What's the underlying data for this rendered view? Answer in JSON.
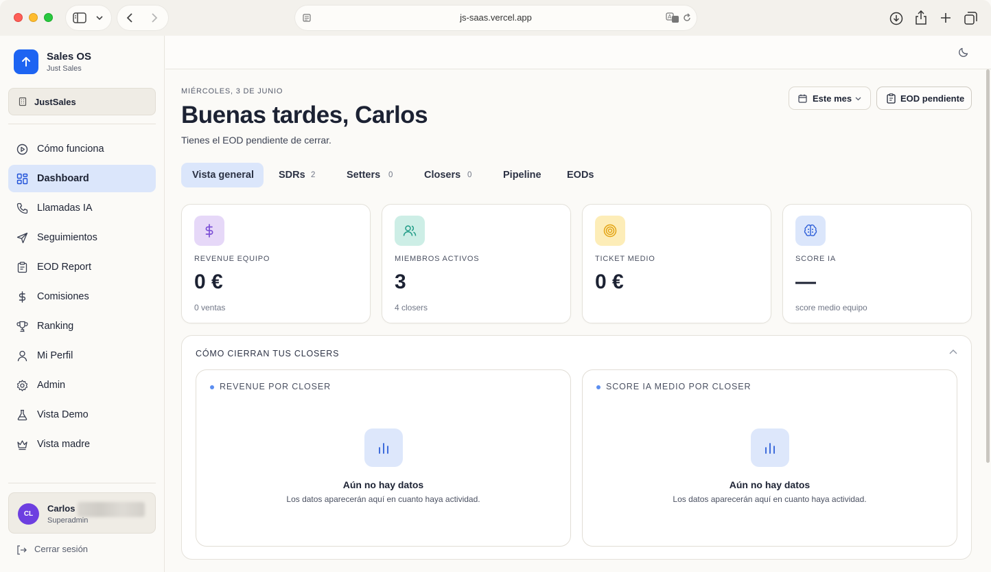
{
  "browser": {
    "url": "js-saas.vercel.app"
  },
  "sidebar": {
    "brand_name": "Sales OS",
    "brand_sub": "Just Sales",
    "workspace": "JustSales",
    "items": [
      {
        "label": "Cómo funciona",
        "icon": "play-circle-icon"
      },
      {
        "label": "Dashboard",
        "icon": "layout-grid-icon",
        "active": true
      },
      {
        "label": "Llamadas IA",
        "icon": "phone-icon"
      },
      {
        "label": "Seguimientos",
        "icon": "send-icon"
      },
      {
        "label": "EOD Report",
        "icon": "clipboard-icon"
      },
      {
        "label": "Comisiones",
        "icon": "dollar-icon"
      },
      {
        "label": "Ranking",
        "icon": "trophy-icon"
      },
      {
        "label": "Mi Perfil",
        "icon": "user-icon"
      },
      {
        "label": "Admin",
        "icon": "gear-icon"
      },
      {
        "label": "Vista Demo",
        "icon": "flask-icon"
      },
      {
        "label": "Vista madre",
        "icon": "crown-icon"
      }
    ],
    "user": {
      "initials": "CL",
      "name": "Carlos",
      "role": "Superadmin"
    },
    "logout": "Cerrar sesión"
  },
  "header": {
    "date": "MIÉRCOLES, 3 DE JUNIO",
    "greeting": "Buenas tardes, Carlos",
    "subtitle": "Tienes el EOD pendiente de cerrar.",
    "period_button": "Este mes",
    "eod_button": "EOD pendiente"
  },
  "tabs": [
    {
      "label": "Vista general",
      "count": ""
    },
    {
      "label": "SDRs",
      "count": "2"
    },
    {
      "label": "Setters",
      "count": "0"
    },
    {
      "label": "Closers",
      "count": "0"
    },
    {
      "label": "Pipeline",
      "count": ""
    },
    {
      "label": "EODs",
      "count": ""
    }
  ],
  "stats": [
    {
      "label": "REVENUE EQUIPO",
      "value": "0 €",
      "sub": "0 ventas",
      "icon": "dollar-icon",
      "color": "#e6d8f8",
      "icon_color": "#7b4fd6"
    },
    {
      "label": "MIEMBROS ACTIVOS",
      "value": "3",
      "sub": "4 closers",
      "icon": "users-icon",
      "color": "#cdeee6",
      "icon_color": "#1f9b86"
    },
    {
      "label": "TICKET MEDIO",
      "value": "0 €",
      "sub": "",
      "icon": "target-icon",
      "color": "#fdedb8",
      "icon_color": "#e3a413"
    },
    {
      "label": "SCORE IA",
      "value": "—",
      "sub": "score medio equipo",
      "icon": "brain-icon",
      "color": "#dbe6fb",
      "icon_color": "#2d5ed8"
    }
  ],
  "section": {
    "title": "CÓMO CIERRAN TUS CLOSERS",
    "panels": [
      {
        "title": "REVENUE POR CLOSER",
        "empty_title": "Aún no hay datos",
        "empty_sub": "Los datos aparecerán aquí en cuanto haya actividad."
      },
      {
        "title": "SCORE IA MEDIO POR CLOSER",
        "empty_title": "Aún no hay datos",
        "empty_sub": "Los datos aparecerán aquí en cuanto haya actividad."
      }
    ]
  }
}
